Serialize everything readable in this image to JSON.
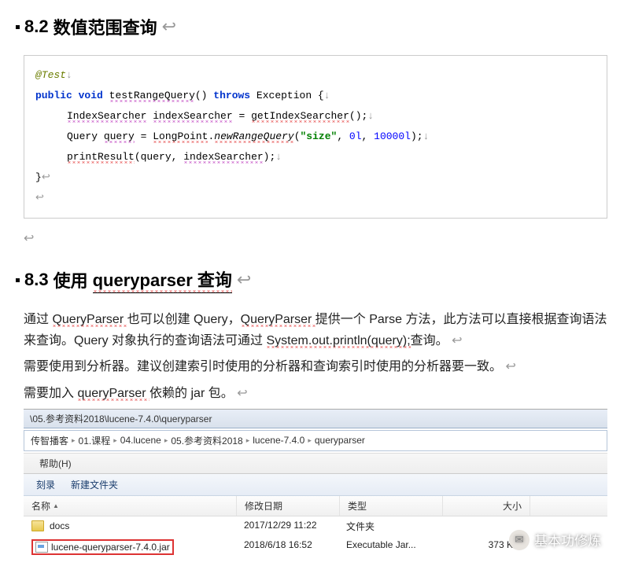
{
  "heading1": {
    "number": "8.2",
    "title": "数值范围查询"
  },
  "code": {
    "annotation": "@Test",
    "kw_public": "public",
    "kw_void": "void",
    "method": "testRangeQuery",
    "parens": "()",
    "kw_throws": "throws",
    "exception": "Exception {",
    "l2_type": "IndexSearcher",
    "l2_var": "indexSearcher",
    "l2_eq": " = ",
    "l2_call": "getIndexSearcher",
    "l2_end": "();",
    "l3_type": "Query ",
    "l3_var": "query",
    "l3_eq": " = ",
    "l3_cls": "LongPoint",
    "l3_dot": ".",
    "l3_method": "newRangeQuery",
    "l3_open": "(",
    "l3_str": "\"size\"",
    "l3_c1": ", ",
    "l3_n1": "0l",
    "l3_c2": ", ",
    "l3_n2": "10000l",
    "l3_close": ");",
    "l4_call": "printResult",
    "l4_args": "(query, ",
    "l4_arg2": "indexSearcher",
    "l4_end": ");",
    "l5": "}"
  },
  "heading2": {
    "number": "8.3",
    "prefix": "使用 ",
    "underlined": "queryparser 查询"
  },
  "para": {
    "p1a": "通过 ",
    "p1b": "QueryParser ",
    "p1c": "也可以创建 Query，",
    "p1d": "QueryParser ",
    "p1e": "提供一个 Parse 方法，此方法可以直接根据查询语法来查询。Query 对象执行的查询语法可通过 ",
    "p1f": "System.out.println(query);",
    "p1g": "查询。",
    "p2": "需要使用到分析器。建议创建索引时使用的分析器和查询索引时使用的分析器要一致。",
    "p3a": "需要加入 ",
    "p3b": "queryParser ",
    "p3c": "依赖的 jar 包。"
  },
  "explorer": {
    "path": "\\05.参考资料2018\\lucene-7.4.0\\queryparser",
    "crumbs": [
      "传智播客",
      "01.课程",
      "04.lucene",
      "05.参考资料2018",
      "lucene-7.4.0",
      "queryparser"
    ],
    "menu_help": "帮助(H)",
    "tb_burn": "刻录",
    "tb_newfolder": "新建文件夹",
    "cols": {
      "name": "名称",
      "date": "修改日期",
      "type": "类型",
      "size": "大小"
    },
    "rows": [
      {
        "icon": "folder",
        "name": "docs",
        "date": "2017/12/29 11:22",
        "type": "文件夹",
        "size": ""
      },
      {
        "icon": "jar",
        "name": "lucene-queryparser-7.4.0.jar",
        "date": "2018/6/18 16:52",
        "type": "Executable Jar...",
        "size": "373 KB",
        "selected": true
      }
    ]
  },
  "watermark": "基本功修炼"
}
